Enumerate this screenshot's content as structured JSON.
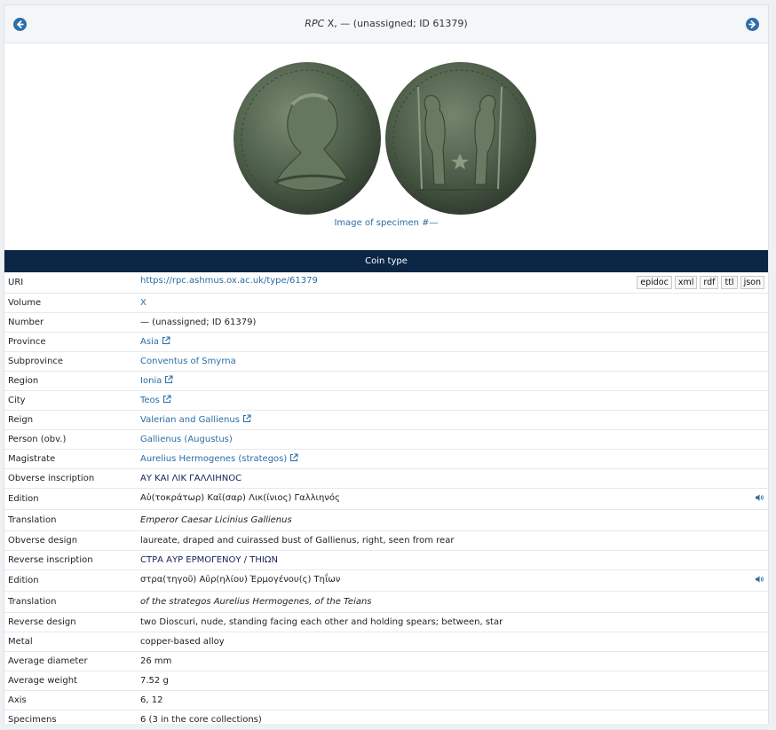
{
  "header": {
    "title_prefix": "RPC",
    "title_rest": " X, — (unassigned; ID 61379)"
  },
  "image": {
    "caption": "Image of specimen #—"
  },
  "coin_type": {
    "heading": "Coin type",
    "formats": [
      "epidoc",
      "xml",
      "rdf",
      "ttl",
      "json"
    ],
    "rows": [
      {
        "label": "URI",
        "value": "https://rpc.ashmus.ox.ac.uk/type/61379"
      },
      {
        "label": "Volume",
        "value": "X"
      },
      {
        "label": "Number",
        "value": "— (unassigned; ID 61379)"
      },
      {
        "label": "Province",
        "value": "Asia"
      },
      {
        "label": "Subprovince",
        "value": "Conventus of Smyrna"
      },
      {
        "label": "Region",
        "value": "Ionia"
      },
      {
        "label": "City",
        "value": "Teos"
      },
      {
        "label": "Reign",
        "value": "Valerian and Gallienus"
      },
      {
        "label": "Person (obv.)",
        "value": "Gallienus (Augustus)"
      },
      {
        "label": "Magistrate",
        "value": "Aurelius Hermogenes (strategos)"
      },
      {
        "label": "Obverse inscription",
        "value": "ΑΥ ΚΑΙ ΛΙΚ ΓΑΛΛΙΗΝΟϹ"
      },
      {
        "label": "Edition",
        "value": "Αὐ(τοκράτωρ) Καῖ(σαρ) Λικ(ίνιος) Γαλλιηνός"
      },
      {
        "label": "Translation",
        "value": "Emperor Caesar Licinius Gallienus"
      },
      {
        "label": "Obverse design",
        "value": "laureate, draped and cuirassed bust of Gallienus, right, seen from rear"
      },
      {
        "label": "Reverse inscription",
        "value": "ϹΤΡΑ ΑΥΡ ΕΡΜΟΓΕΝΟΥ / ΤΗΙΩΝ"
      },
      {
        "label": "Edition",
        "value": "στρα(τηγοῦ) Αὐρ(ηλίου) Ἑρμογένου(ς) Τηΐων"
      },
      {
        "label": "Translation",
        "value": "of the strategos Aurelius Hermogenes, of the Teians"
      },
      {
        "label": "Reverse design",
        "value": "two Dioscuri, nude, standing facing each other and holding spears; between, star"
      },
      {
        "label": "Metal",
        "value": "copper-based alloy"
      },
      {
        "label": "Average diameter",
        "value": "26 mm"
      },
      {
        "label": "Average weight",
        "value": "7.52 g"
      },
      {
        "label": "Axis",
        "value": "6, 12"
      },
      {
        "label": "Specimens",
        "value": "6 (3 in the core collections)"
      }
    ]
  },
  "icons": {
    "prev": "arrow-left-circle-icon",
    "next": "arrow-right-circle-icon",
    "external": "external-link-icon",
    "audio": "speaker-icon"
  },
  "colors": {
    "header_bar": "#0a2644",
    "link": "#2a6da5",
    "nav_button": "#2e6fa8",
    "greek_text": "#15205a",
    "coin_patina": "#4a5c46"
  }
}
